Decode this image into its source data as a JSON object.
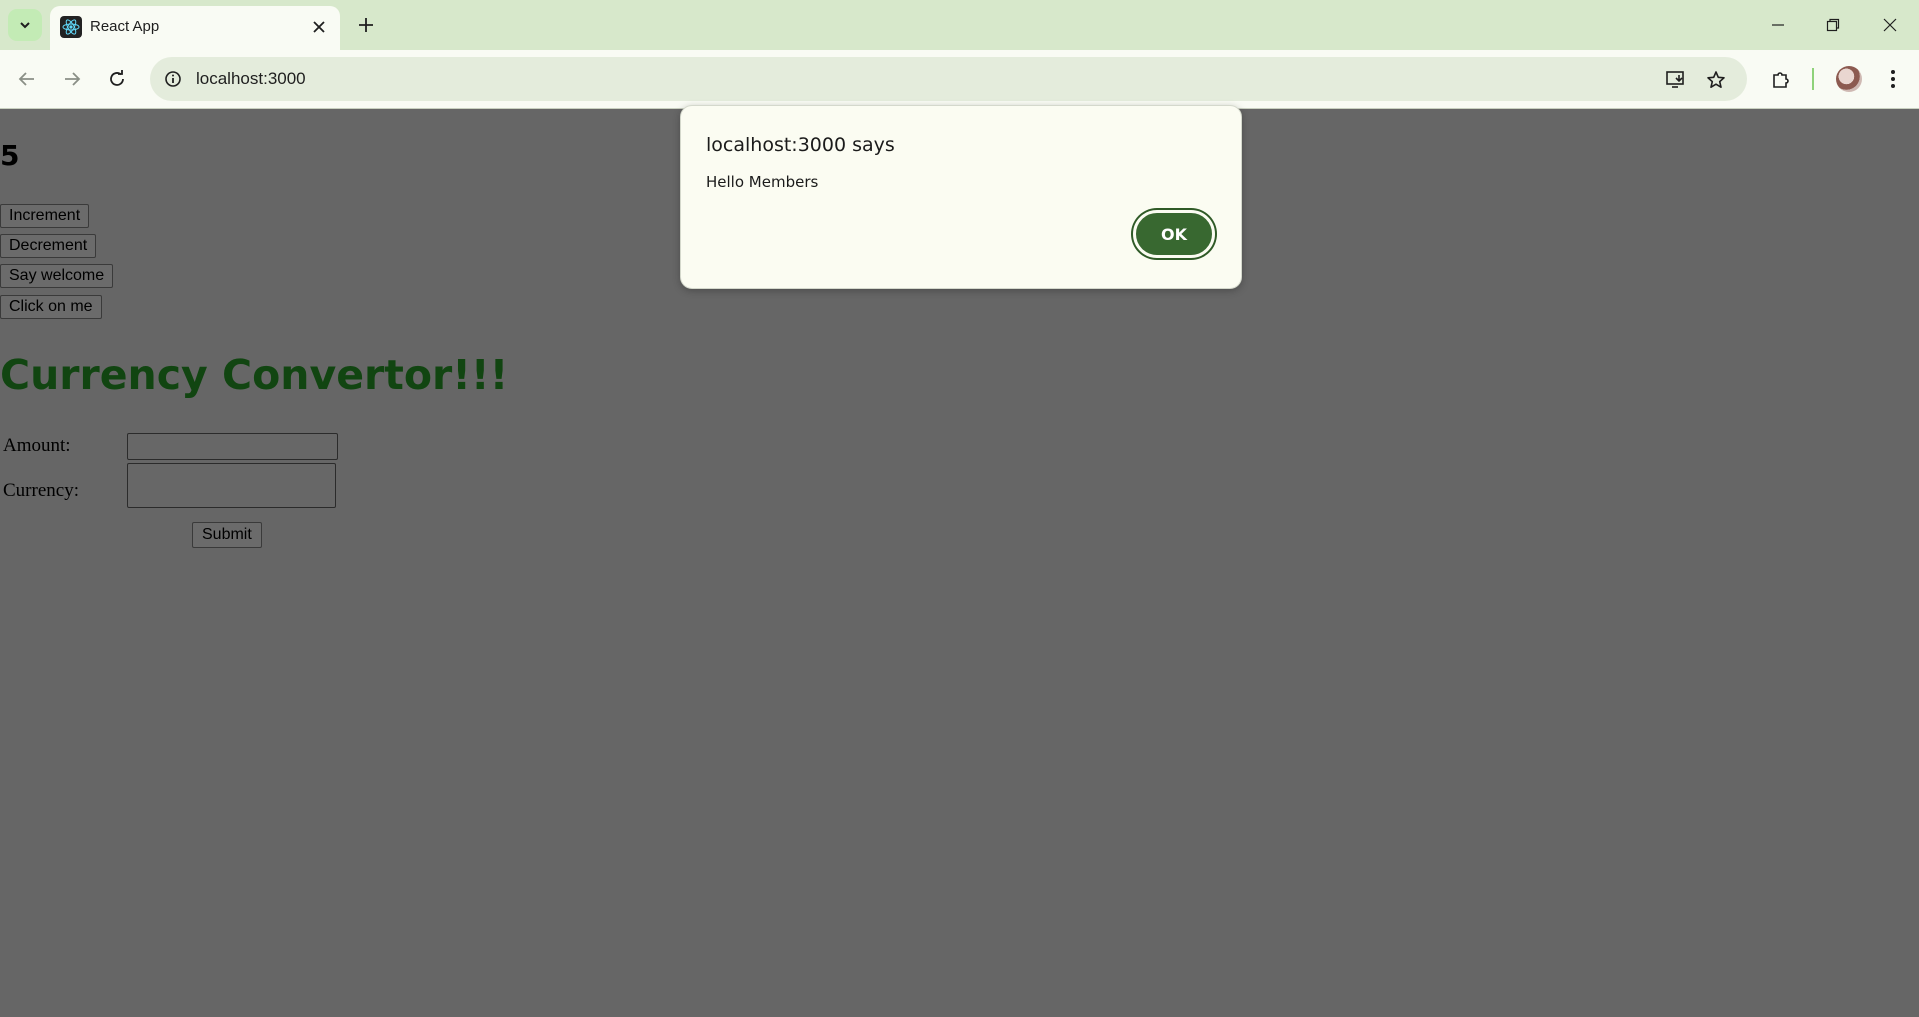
{
  "browser": {
    "tab_title": "React App",
    "url": "localhost:3000"
  },
  "page": {
    "counter_value": "5",
    "buttons": [
      "Increment",
      "Decrement",
      "Say welcome",
      "Click on me"
    ],
    "heading": "Currency Convertor!!!",
    "form": {
      "amount_label": "Amount:",
      "amount_value": "",
      "currency_label": "Currency:",
      "currency_value": "",
      "submit_label": "Submit"
    },
    "heading_color": "#114511"
  },
  "dialog": {
    "title": "localhost:3000 says",
    "message": "Hello Members",
    "ok_label": "OK",
    "accent_color": "#386830"
  },
  "icons": [
    "chevron-down-icon",
    "react-icon",
    "close-icon",
    "plus-icon",
    "minimize-icon",
    "restore-icon",
    "back-icon",
    "forward-icon",
    "reload-icon",
    "info-icon",
    "install-icon",
    "star-icon",
    "extensions-icon",
    "menu-icon"
  ]
}
